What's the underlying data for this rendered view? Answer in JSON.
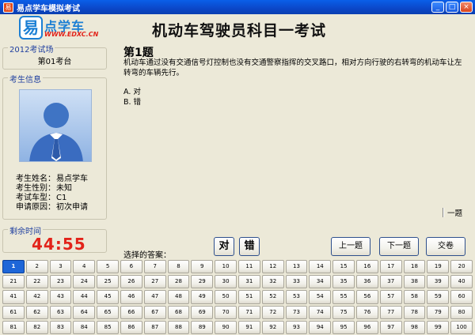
{
  "window": {
    "title": "易点学车模拟考试",
    "controls": [
      "_",
      "□",
      "×"
    ]
  },
  "logo": {
    "mark": "易",
    "name": "点学车",
    "url": "WWW.EDXC.CN"
  },
  "header": {
    "exam_title": "机动车驾驶员科目一考试"
  },
  "venue": {
    "label": "2012考试场",
    "seat": "第01考台"
  },
  "candidate": {
    "label": "考生信息",
    "rows": [
      {
        "k": "考生姓名：",
        "v": "易点学车"
      },
      {
        "k": "考生性别：",
        "v": "未知"
      },
      {
        "k": "考试车型：",
        "v": "C1"
      },
      {
        "k": "申请原因：",
        "v": "初次申请"
      }
    ]
  },
  "timer": {
    "label": "剩余时间",
    "time": "44:55"
  },
  "question": {
    "number": "第1题",
    "text": "机动车通过没有交通信号灯控制也没有交通警察指挥的交叉路口，相对方向行驶的右转弯的机动车让左转弯的车辆先行。",
    "options": [
      "A. 对",
      "B. 错"
    ]
  },
  "side_hint": "一题",
  "answer": {
    "label": "选择的答案：",
    "true_label": "对",
    "false_label": "错"
  },
  "nav": {
    "prev": "上一题",
    "next": "下一题",
    "submit": "交卷"
  },
  "grid": {
    "current": 1,
    "numbers": [
      1,
      2,
      3,
      4,
      5,
      6,
      7,
      8,
      9,
      10,
      11,
      12,
      13,
      14,
      15,
      16,
      17,
      18,
      19,
      20,
      21,
      22,
      23,
      24,
      25,
      26,
      27,
      28,
      29,
      30,
      31,
      32,
      33,
      34,
      35,
      36,
      37,
      38,
      39,
      40,
      41,
      42,
      43,
      44,
      45,
      46,
      47,
      48,
      49,
      50,
      51,
      52,
      53,
      54,
      55,
      56,
      57,
      58,
      59,
      60,
      61,
      62,
      63,
      64,
      65,
      66,
      67,
      68,
      69,
      70,
      71,
      72,
      73,
      74,
      75,
      76,
      77,
      78,
      79,
      80,
      81,
      82,
      83,
      84,
      85,
      86,
      87,
      88,
      89,
      90,
      91,
      92,
      93,
      94,
      95,
      96,
      97,
      98,
      99,
      100
    ]
  },
  "colors": {
    "accent": "#1E66D8",
    "timer": "#E2231A",
    "group_label": "#1F3F9F"
  }
}
